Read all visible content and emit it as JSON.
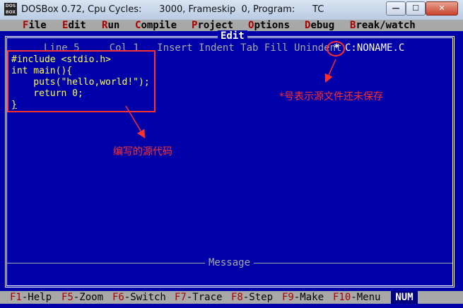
{
  "window": {
    "app_icon_text": "DOS BOX",
    "title": "DOSBox 0.72, Cpu Cycles:      3000, Frameskip  0, Program:      TC",
    "buttons": {
      "minimize": "—",
      "maximize": "☐",
      "close": "✕"
    }
  },
  "menu": [
    {
      "hot": "F",
      "rest": "ile"
    },
    {
      "hot": "E",
      "rest": "dit"
    },
    {
      "hot": "R",
      "rest": "un"
    },
    {
      "hot": "C",
      "rest": "ompile"
    },
    {
      "hot": "P",
      "rest": "roject"
    },
    {
      "hot": "O",
      "rest": "ptions"
    },
    {
      "hot": "D",
      "rest": "ebug"
    },
    {
      "hot": "B",
      "rest": "reak/watch"
    }
  ],
  "editor": {
    "title": "Edit",
    "status": "Line 5     Col 1   Insert Indent Tab Fill Unindent",
    "modified_marker": "*",
    "file_name": "C:NONAME.C",
    "code_lines": [
      "#include <stdio.h>",
      "int main(){",
      "    puts(\"hello,world!\");",
      "    return 0;",
      "}"
    ]
  },
  "message_panel": {
    "title": "Message"
  },
  "function_keys": [
    {
      "key": "F1",
      "label": "-Help"
    },
    {
      "key": "F5",
      "label": "-Zoom"
    },
    {
      "key": "F6",
      "label": "-Switch"
    },
    {
      "key": "F7",
      "label": "-Trace"
    },
    {
      "key": "F8",
      "label": "-Step"
    },
    {
      "key": "F9",
      "label": "-Make"
    },
    {
      "key": "F10",
      "label": "-Menu"
    }
  ],
  "num_indicator": "NUM",
  "annotations": {
    "source_code_label": "编写的源代码",
    "unsaved_label": "*号表示源文件还未保存",
    "color": "#ff3030"
  },
  "colors": {
    "dos_blue": "#0000a8",
    "menu_gray": "#a8a8a8",
    "hotkey_red": "#a80000",
    "code_yellow": "#ffff55"
  }
}
